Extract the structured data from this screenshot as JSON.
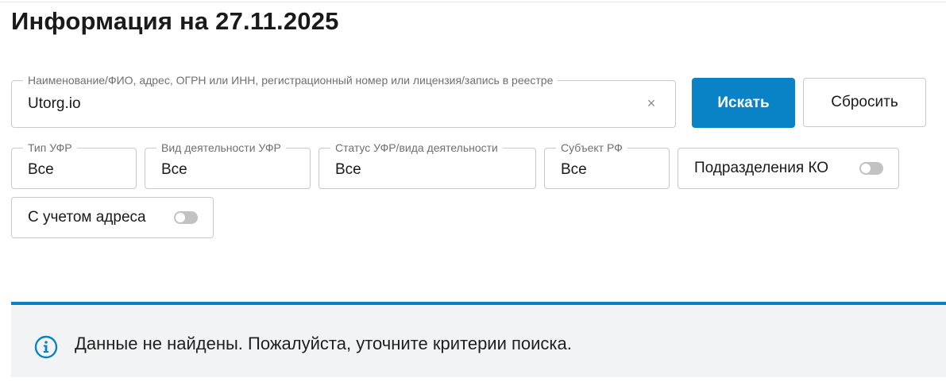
{
  "page": {
    "title": "Информация на 27.11.2025"
  },
  "search": {
    "label": "Наименование/ФИО, адрес, ОГРН или ИНН, регистрационный номер или лицензия/запись в реестре",
    "value": "Utorg.io",
    "clear_symbol": "×"
  },
  "buttons": {
    "search_label": "Искать",
    "reset_label": "Сбросить"
  },
  "filters": [
    {
      "label": "Тип УФР",
      "value": "Все"
    },
    {
      "label": "Вид деятельности УФР",
      "value": "Все"
    },
    {
      "label": "Статус УФР/вида деятельности",
      "value": "Все"
    },
    {
      "label": "Субъект РФ",
      "value": "Все"
    }
  ],
  "toggles": {
    "branches_label": "Подразделения КО",
    "branches_on": false,
    "address_label": "С учетом адреса",
    "address_on": false
  },
  "notice": {
    "icon": "info-icon",
    "text": "Данные не найдены. Пожалуйста, уточните критерии поиска.",
    "accent_color": "#0a83c6"
  }
}
